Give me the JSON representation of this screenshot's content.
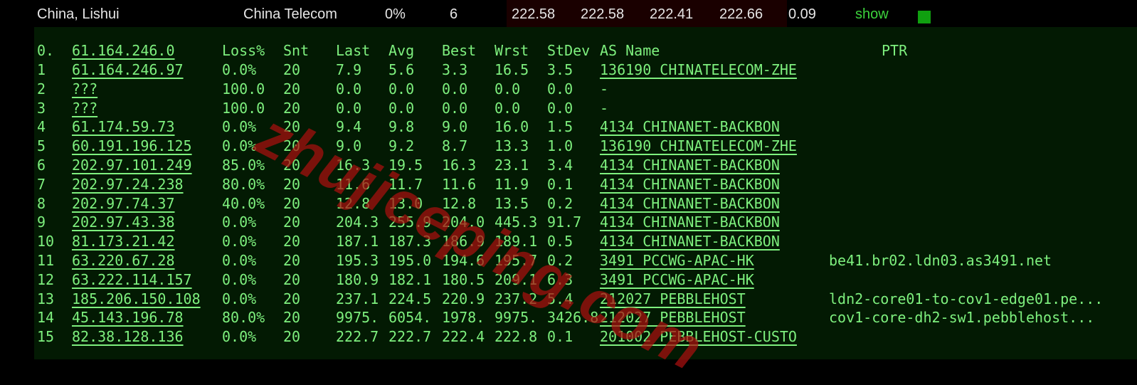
{
  "summary_row": {
    "location": "China, Lishui",
    "isp": "China Telecom",
    "loss": "0%",
    "sent": "6",
    "last": "222.58",
    "avg": "222.58",
    "best": "222.41",
    "worst": "222.66",
    "stdev": "0.09",
    "action": "show"
  },
  "columns": {
    "hop": "0.",
    "host": "61.164.246.0",
    "loss": "Loss%",
    "sent": "Snt",
    "last": "Last",
    "avg": "Avg",
    "best": "Best",
    "worst": "Wrst",
    "stdev": "StDev",
    "as_name": "AS Name",
    "ptr": "PTR"
  },
  "hops": [
    {
      "hop": "1",
      "host": "61.164.246.97",
      "loss": "0.0%",
      "sent": "20",
      "last": "7.9",
      "avg": "5.6",
      "best": "3.3",
      "worst": "16.5",
      "stdev": "3.5",
      "as_name": "136190 CHINATELECOM-ZHE",
      "ptr": ""
    },
    {
      "hop": "2",
      "host": "???",
      "loss": "100.0",
      "sent": "20",
      "last": "0.0",
      "avg": "0.0",
      "best": "0.0",
      "worst": "0.0",
      "stdev": "0.0",
      "as_name": "-",
      "ptr": ""
    },
    {
      "hop": "3",
      "host": "???",
      "loss": "100.0",
      "sent": "20",
      "last": "0.0",
      "avg": "0.0",
      "best": "0.0",
      "worst": "0.0",
      "stdev": "0.0",
      "as_name": "-",
      "ptr": ""
    },
    {
      "hop": "4",
      "host": "61.174.59.73",
      "loss": "0.0%",
      "sent": "20",
      "last": "9.4",
      "avg": "9.8",
      "best": "9.0",
      "worst": "16.0",
      "stdev": "1.5",
      "as_name": "4134  CHINANET-BACKBON",
      "ptr": ""
    },
    {
      "hop": "5",
      "host": "60.191.196.125",
      "loss": "0.0%",
      "sent": "20",
      "last": "9.0",
      "avg": "9.2",
      "best": "8.7",
      "worst": "13.3",
      "stdev": "1.0",
      "as_name": "136190 CHINATELECOM-ZHE",
      "ptr": ""
    },
    {
      "hop": "6",
      "host": "202.97.101.249",
      "loss": "85.0%",
      "sent": "20",
      "last": "16.3",
      "avg": "19.5",
      "best": "16.3",
      "worst": "23.1",
      "stdev": "3.4",
      "as_name": "4134  CHINANET-BACKBON",
      "ptr": ""
    },
    {
      "hop": "7",
      "host": "202.97.24.238",
      "loss": "80.0%",
      "sent": "20",
      "last": "11.6",
      "avg": "11.7",
      "best": "11.6",
      "worst": "11.9",
      "stdev": "0.1",
      "as_name": "4134  CHINANET-BACKBON",
      "ptr": ""
    },
    {
      "hop": "8",
      "host": "202.97.74.37",
      "loss": "40.0%",
      "sent": "20",
      "last": "12.8",
      "avg": "13.0",
      "best": "12.8",
      "worst": "13.5",
      "stdev": "0.2",
      "as_name": "4134  CHINANET-BACKBON",
      "ptr": ""
    },
    {
      "hop": "9",
      "host": "202.97.43.38",
      "loss": "0.0%",
      "sent": "20",
      "last": "204.3",
      "avg": "255.9",
      "best": "204.0",
      "worst": "445.3",
      "stdev": "91.7",
      "as_name": "4134  CHINANET-BACKBON",
      "ptr": ""
    },
    {
      "hop": "10",
      "host": "81.173.21.42",
      "loss": "0.0%",
      "sent": "20",
      "last": "187.1",
      "avg": "187.3",
      "best": "186.9",
      "worst": "189.1",
      "stdev": "0.5",
      "as_name": "4134  CHINANET-BACKBON",
      "ptr": ""
    },
    {
      "hop": "11",
      "host": "63.220.67.28",
      "loss": "0.0%",
      "sent": "20",
      "last": "195.3",
      "avg": "195.0",
      "best": "194.6",
      "worst": "195.7",
      "stdev": "0.2",
      "as_name": "3491  PCCWG-APAC-HK",
      "ptr": "be41.br02.ldn03.as3491.net"
    },
    {
      "hop": "12",
      "host": "63.222.114.157",
      "loss": "0.0%",
      "sent": "20",
      "last": "180.9",
      "avg": "182.1",
      "best": "180.5",
      "worst": "209.1",
      "stdev": "6.3",
      "as_name": "3491  PCCWG-APAC-HK",
      "ptr": ""
    },
    {
      "hop": "13",
      "host": "185.206.150.108",
      "loss": "0.0%",
      "sent": "20",
      "last": "237.1",
      "avg": "224.5",
      "best": "220.9",
      "worst": "237.2",
      "stdev": "5.4",
      "as_name": "212027 PEBBLEHOST",
      "ptr": "ldn2-core01-to-cov1-edge01.pe..."
    },
    {
      "hop": "14",
      "host": "45.143.196.78",
      "loss": "80.0%",
      "sent": "20",
      "last": "9975.",
      "avg": "6054.",
      "best": "1978.",
      "worst": "9975.",
      "stdev": "3426.8",
      "as_name": "212027 PEBBLEHOST",
      "ptr": "cov1-core-dh2-sw1.pebblehost..."
    },
    {
      "hop": "15",
      "host": "82.38.128.136",
      "loss": "0.0%",
      "sent": "20",
      "last": "222.7",
      "avg": "222.7",
      "best": "222.4",
      "worst": "222.8",
      "stdev": "0.1",
      "as_name": "201002 PEBBLEHOST-CUSTO",
      "ptr": ""
    }
  ],
  "watermark": "zhujiceping.com"
}
